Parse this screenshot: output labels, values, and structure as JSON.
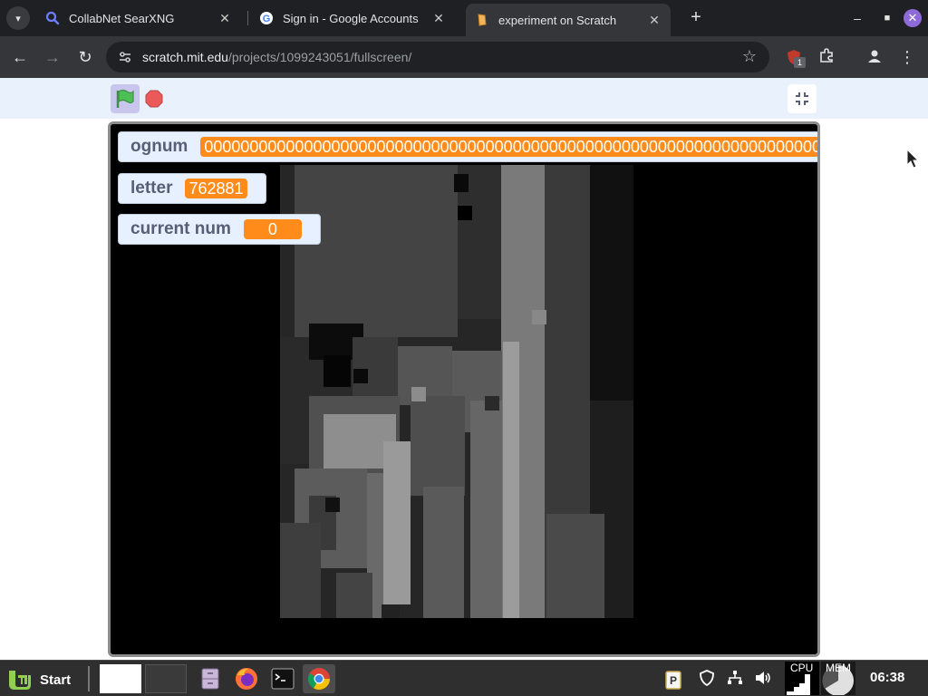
{
  "browser": {
    "tabs": [
      {
        "title": "CollabNet SearXNG",
        "favicon": "search-icon",
        "active": false
      },
      {
        "title": "Sign in - Google Accounts",
        "favicon": "google-icon",
        "active": false
      },
      {
        "title": "experiment on Scratch",
        "favicon": "scratch-icon",
        "active": true
      }
    ],
    "url_host": "scratch.mit.edu",
    "url_path": "/projects/1099243051/fullscreen/",
    "extension_badge": "1"
  },
  "scratch": {
    "monitors": [
      {
        "label": "ognum",
        "value": "00000000000000000000000000000000000000000000000000000000000000000000000"
      },
      {
        "label": "letter",
        "value": "762881"
      },
      {
        "label": "current num",
        "value": "0"
      }
    ]
  },
  "taskbar": {
    "start_label": "Start",
    "cpu_label": "CPU",
    "mem_label": "MEM",
    "clock": "06:38"
  },
  "colors": {
    "monitor_value_bg": "#ff8c1a",
    "scratch_header_bg": "#e9f1fc",
    "flag_green": "#4cbf56",
    "stop_red": "#ec5959"
  }
}
